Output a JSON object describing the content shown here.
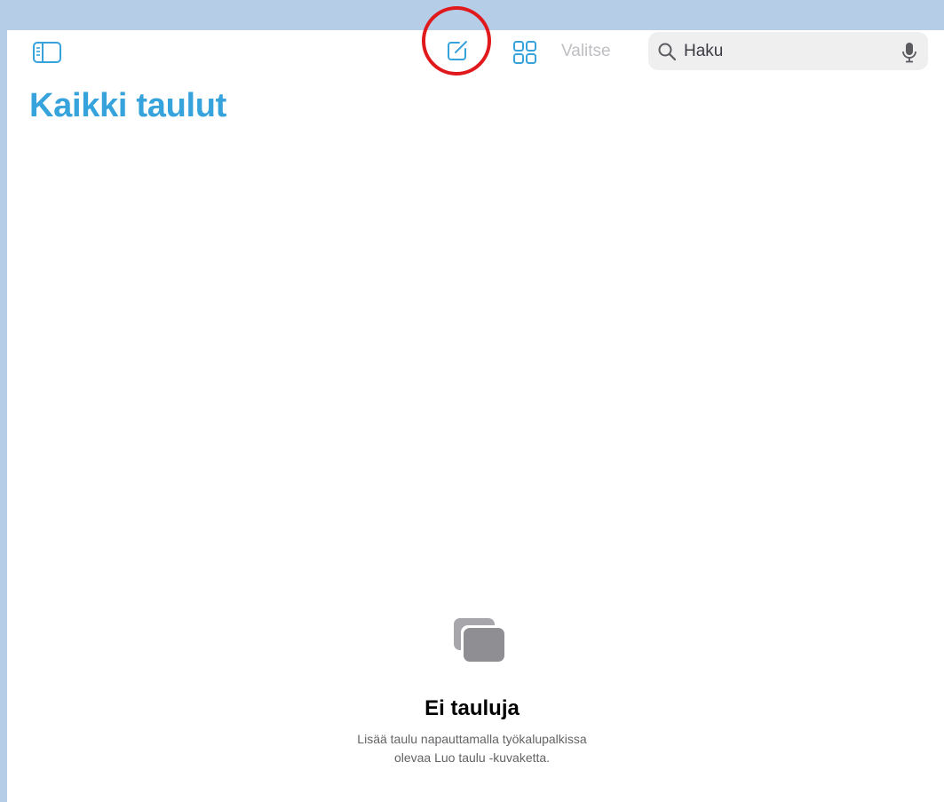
{
  "toolbar": {
    "sidebar_toggle_icon": "sidebar-icon",
    "compose_icon": "square-and-pencil-icon",
    "grid_icon": "grid-icon",
    "select_label": "Valitse",
    "search": {
      "placeholder": "Haku",
      "search_icon": "magnifying-glass-icon",
      "mic_icon": "microphone-icon"
    }
  },
  "page": {
    "title": "Kaikki taulut"
  },
  "empty_state": {
    "icon": "boards-stack-icon",
    "title": "Ei tauluja",
    "description_line1": "Lisää taulu napauttamalla työkalupalkissa",
    "description_line2": "olevaa Luo taulu -kuvaketta."
  },
  "colors": {
    "accent": "#36a3dc",
    "annotation": "#e0191d",
    "frame": "#b6cde8",
    "muted_text": "#bfbfc3"
  }
}
